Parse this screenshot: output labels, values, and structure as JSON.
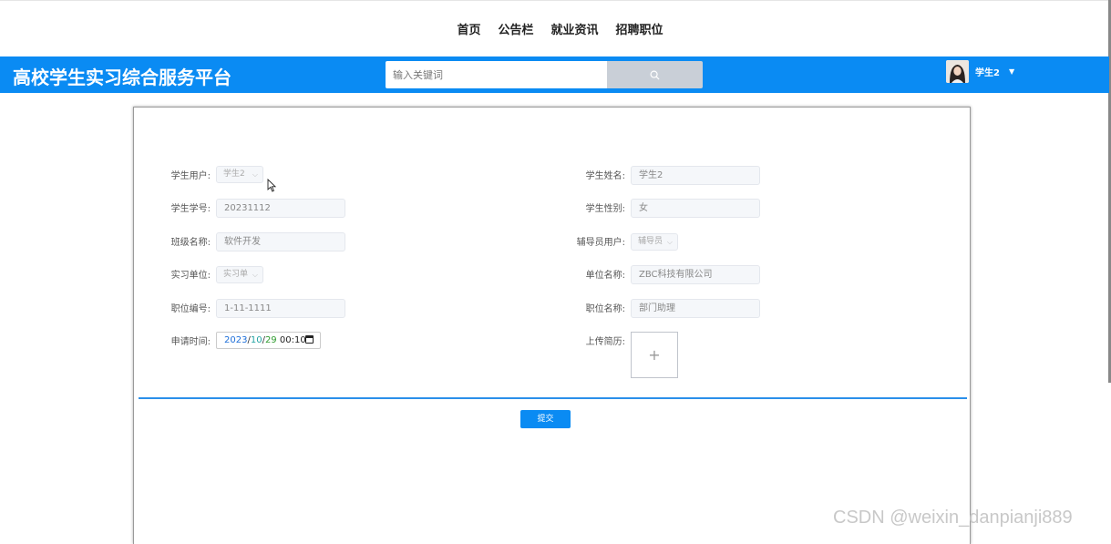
{
  "nav": {
    "items": [
      "首页",
      "公告栏",
      "就业资讯",
      "招聘职位"
    ]
  },
  "header": {
    "brand": "高校学生实习综合服务平台",
    "search_placeholder": "输入关键词",
    "username": "学生2",
    "caret": "▼"
  },
  "icons": {
    "search": "search-icon",
    "avatar": "avatar-image",
    "calendar": "calendar-icon",
    "caret": "chevron-down-icon"
  },
  "form": {
    "student_user": {
      "label": "学生用户:",
      "value": "学生2"
    },
    "student_name": {
      "label": "学生姓名:",
      "value": "学生2"
    },
    "student_no": {
      "label": "学生学号:",
      "value": "20231112"
    },
    "gender": {
      "label": "学生性别:",
      "value": "女"
    },
    "class_name": {
      "label": "班级名称:",
      "value": "软件开发"
    },
    "counselor": {
      "label": "辅导员用户:",
      "value": "辅导员"
    },
    "intern_unit": {
      "label": "实习单位:",
      "value": "实习单"
    },
    "unit_name": {
      "label": "单位名称:",
      "value": "ZBC科技有限公司"
    },
    "position_no": {
      "label": "职位编号:",
      "value": "1-11-1111"
    },
    "position_name": {
      "label": "职位名称:",
      "value": "部门助理"
    },
    "apply_time": {
      "label": "申请时间:",
      "year": "2023",
      "month": "10",
      "day": "29",
      "time": "00:10",
      "sep": "/"
    },
    "resume": {
      "label": "上传简历:",
      "plus": "+"
    },
    "submit": "提交"
  },
  "watermark": "CSDN @weixin_danpianji889",
  "colors": {
    "primary": "#0a8bf3",
    "divider": "#2a8fea"
  }
}
